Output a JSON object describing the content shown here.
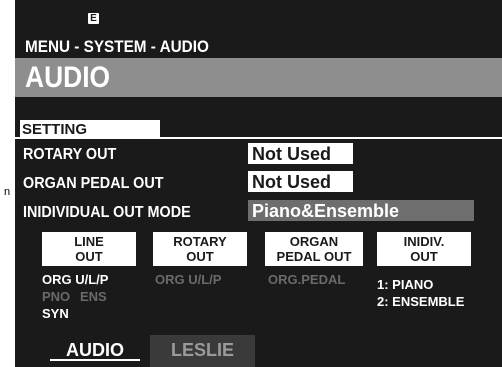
{
  "side_mark": "n",
  "header": {
    "badge": "E",
    "path": "MENU - SYSTEM - AUDIO",
    "title": "AUDIO"
  },
  "section": {
    "label": "SETTING"
  },
  "settings": [
    {
      "label": "ROTARY OUT",
      "value": "Not Used"
    },
    {
      "label": "ORGAN PEDAL OUT",
      "value": "Not Used"
    },
    {
      "label": "INIDIVIDUAL OUT MODE",
      "value": "Piano&Ensemble"
    }
  ],
  "outputs": [
    {
      "line1": "LINE",
      "line2": "OUT"
    },
    {
      "line1": "ROTARY",
      "line2": "OUT"
    },
    {
      "line1": "ORGAN",
      "line2": "PEDAL OUT"
    },
    {
      "line1": "INIDIV.",
      "line2": "OUT"
    }
  ],
  "output_info": {
    "line_out": {
      "row1": "ORG U/L/P",
      "row2a": "PNO",
      "row2b": "ENS",
      "row3": "SYN"
    },
    "rotary_out": {
      "row1": "ORG U/L/P"
    },
    "organ_pedal_out": {
      "row1": "ORG.PEDAL"
    },
    "indiv_out": {
      "row1": "1: PIANO",
      "row2": "2: ENSEMBLE"
    }
  },
  "tabs": [
    {
      "label": "AUDIO",
      "active": true
    },
    {
      "label": "LESLIE",
      "active": false
    }
  ],
  "colors": {
    "screen_bg": "#1a1a1a",
    "title_bar": "#8e8e8e",
    "selected_value": "#6e6e6e",
    "dim_text": "#6a6a6a"
  }
}
